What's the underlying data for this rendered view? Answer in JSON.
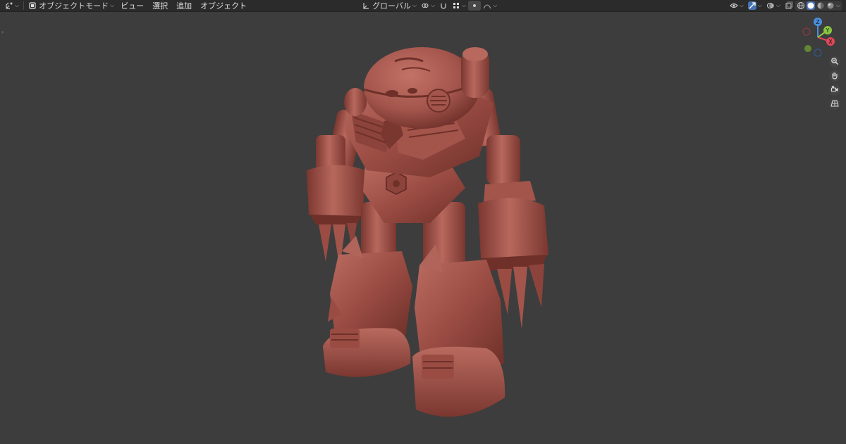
{
  "header": {
    "mode_label": "オブジェクトモード",
    "menus": [
      "ビュー",
      "選択",
      "追加",
      "オブジェクト"
    ],
    "transform_orientation": "グローバル"
  },
  "gizmo": {
    "x": "X",
    "y": "Y",
    "z": "Z"
  },
  "icons": {
    "editor_type": "editor-type-icon",
    "mode": "object-mode-icon",
    "orientation": "transform-orientation-icon",
    "pivot": "pivot-point-icon",
    "snap": "snap-magnet-icon",
    "snap_target": "snap-increment-icon",
    "proportional": "proportional-editing-icon",
    "visibility": "object-visibility-icon",
    "gizmo_toggle": "gizmo-toggle-icon",
    "overlay": "overlay-icon",
    "xray": "xray-icon",
    "shading": [
      "wireframe-icon",
      "solid-icon",
      "material-preview-icon",
      "rendered-icon"
    ]
  },
  "colors": {
    "topbar_bg": "#2b2b2b",
    "viewport_bg": "#3d3d3d",
    "model_base": "#a3554c",
    "model_shadow": "#6e3029",
    "model_highlight": "#c87a6f",
    "axis_x": "#e0475a",
    "axis_y": "#88c540",
    "axis_z": "#4a8fe0",
    "active_blue": "#4772b3"
  }
}
